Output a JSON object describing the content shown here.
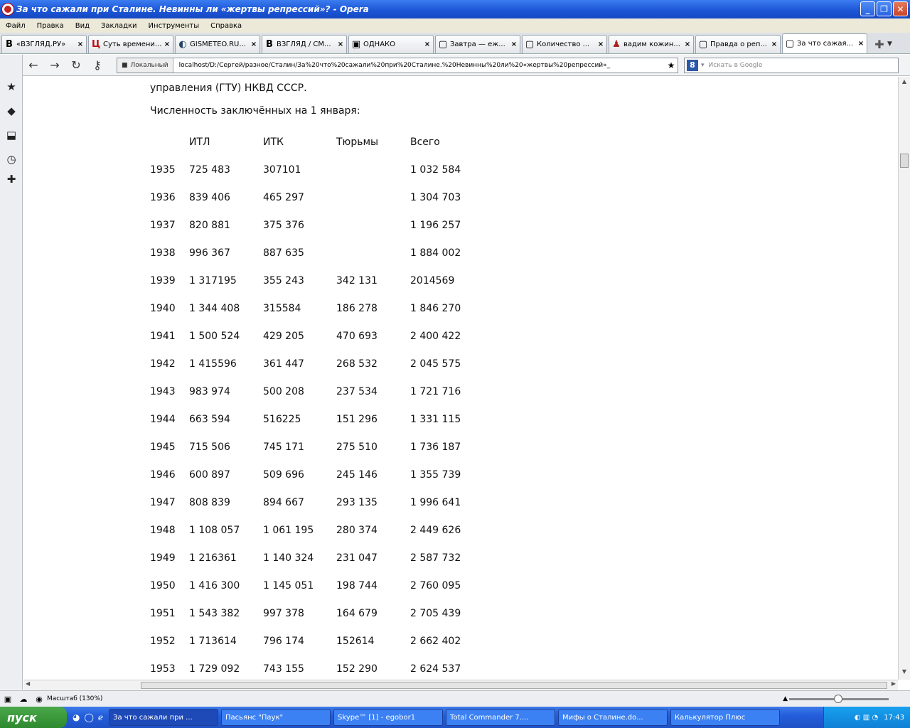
{
  "window": {
    "title": "За что сажали при Сталине. Невинны ли «жертвы репрессий»? - Opera"
  },
  "menu": [
    "Файл",
    "Правка",
    "Вид",
    "Закладки",
    "Инструменты",
    "Справка"
  ],
  "tabs": [
    {
      "icon": "B",
      "label": "«ВЗГЛЯД.РУ»",
      "close": "×"
    },
    {
      "icon": "Ц",
      "label": "Суть времени...",
      "close": "×"
    },
    {
      "icon": "◐",
      "label": "GISMETEO.RU...",
      "close": "×"
    },
    {
      "icon": "B",
      "label": "ВЗГЛЯД / СМ...",
      "close": "×"
    },
    {
      "icon": "▣",
      "label": "ОДНАКО",
      "close": "×"
    },
    {
      "icon": "▢",
      "label": "Завтра — еж...",
      "close": "×"
    },
    {
      "icon": "▢",
      "label": "Количество ...",
      "close": "×"
    },
    {
      "icon": "♟",
      "label": "вадим кожин...",
      "close": "×"
    },
    {
      "icon": "▢",
      "label": "Правда о реп...",
      "close": "×"
    },
    {
      "icon": "▢",
      "label": "За что сажая...",
      "close": "×"
    }
  ],
  "nav": {
    "badge": "Локальный",
    "url": "localhost/D:/Сергей/разное/Сталин/За%20что%20сажали%20при%20Сталине.%20Невинны%20ли%20«жертвы%20репрессий»_",
    "search_placeholder": "Искать в Google"
  },
  "content": {
    "intro": "управления (ГТУ) НКВД СССР.",
    "caption": "Численность заключённых на 1 января:",
    "headers": [
      "",
      "ИТЛ",
      "ИТК",
      "Тюрьмы",
      "Всего"
    ],
    "rows": [
      [
        "1935",
        "725 483",
        "307101",
        "",
        "1 032 584"
      ],
      [
        "1936",
        "839 406",
        "465 297",
        "",
        "1 304 703"
      ],
      [
        "1937",
        "820 881",
        "375 376",
        "",
        "1 196 257"
      ],
      [
        "1938",
        "996 367",
        "887 635",
        "",
        "1 884 002"
      ],
      [
        "1939",
        "1 317195",
        "355 243",
        "342 131",
        "2014569"
      ],
      [
        "1940",
        "1 344 408",
        "315584",
        "186 278",
        "1 846 270"
      ],
      [
        "1941",
        "1 500 524",
        "429 205",
        "470 693",
        "2 400 422"
      ],
      [
        "1942",
        "1 415596",
        "361 447",
        "268 532",
        "2 045 575"
      ],
      [
        "1943",
        "983 974",
        "500 208",
        "237 534",
        "1 721 716"
      ],
      [
        "1944",
        "663 594",
        "516225",
        "151 296",
        "1 331 115"
      ],
      [
        "1945",
        "715 506",
        "745 171",
        "275 510",
        "1 736 187"
      ],
      [
        "1946",
        "600 897",
        "509 696",
        "245 146",
        "1 355 739"
      ],
      [
        "1947",
        "808 839",
        "894 667",
        "293 135",
        "1 996 641"
      ],
      [
        "1948",
        "1 108 057",
        "1 061 195",
        "280 374",
        "2 449 626"
      ],
      [
        "1949",
        "1 216361",
        "1 140 324",
        "231 047",
        "2 587 732"
      ],
      [
        "1950",
        "1 416 300",
        "1 145 051",
        "198 744",
        "2 760 095"
      ],
      [
        "1951",
        "1 543 382",
        "997 378",
        "164 679",
        "2 705 439"
      ],
      [
        "1952",
        "1 713614",
        "796 174",
        "152614",
        "2 662 402"
      ],
      [
        "1953",
        "1 729 092",
        "743 155",
        "152 290",
        "2 624 537"
      ]
    ]
  },
  "status": {
    "zoom": "Масштаб (130%)"
  },
  "taskbar": {
    "start": "пуск",
    "tasks": [
      "За что сажали при ...",
      "Пасьянс \"Паук\"",
      "Skype™ [1] - egobor1",
      "Total Commander 7....",
      "Мифы о Сталине.do...",
      "Калькулятор Плюс"
    ],
    "clock": "17:43"
  }
}
